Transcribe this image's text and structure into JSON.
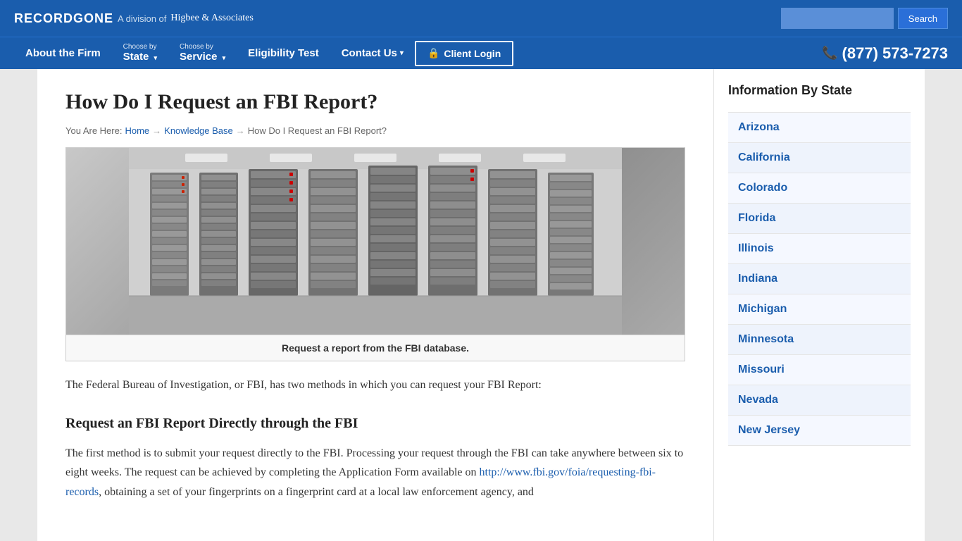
{
  "site": {
    "brand": "RECORDGONE",
    "division_text": "A division of",
    "higbee": "Higbee & Associates"
  },
  "search": {
    "placeholder": "",
    "button_label": "Search"
  },
  "nav": {
    "about_label_small": "",
    "about_label": "About the Firm",
    "choose_state_small": "Choose by",
    "choose_state_main": "State",
    "choose_service_small": "Choose by",
    "choose_service_main": "Service",
    "eligibility": "Eligibility Test",
    "contact": "Contact Us",
    "client_login": "Client Login",
    "phone": "(877) 573-7273"
  },
  "breadcrumb": {
    "you_are_here": "You Are Here:",
    "home": "Home",
    "knowledge_base": "Knowledge Base",
    "current": "How Do I Request an FBI Report?"
  },
  "article": {
    "title": "How Do I Request an FBI Report?",
    "image_caption": "Request a report from the FBI database.",
    "intro": "The Federal Bureau of Investigation, or FBI, has two methods in which you can request your FBI Report:",
    "section1_title": "Request an FBI Report Directly through the FBI",
    "section1_para": "The first method is to submit your request directly to the FBI. Processing your request through the FBI can take anywhere between six to eight weeks. The request can be achieved by completing the Application Form available on",
    "section1_link_text": "http://www.fbi.gov/foia/requesting-fbi-records",
    "section1_link_href": "http://www.fbi.gov/foia/requesting-fbi-records",
    "section1_continued": ", obtaining a set of your fingerprints on a fingerprint card at a local law enforcement agency, and"
  },
  "sidebar": {
    "title": "Information By State",
    "states": [
      "Arizona",
      "California",
      "Colorado",
      "Florida",
      "Illinois",
      "Indiana",
      "Michigan",
      "Minnesota",
      "Missouri",
      "Nevada",
      "New Jersey"
    ]
  }
}
